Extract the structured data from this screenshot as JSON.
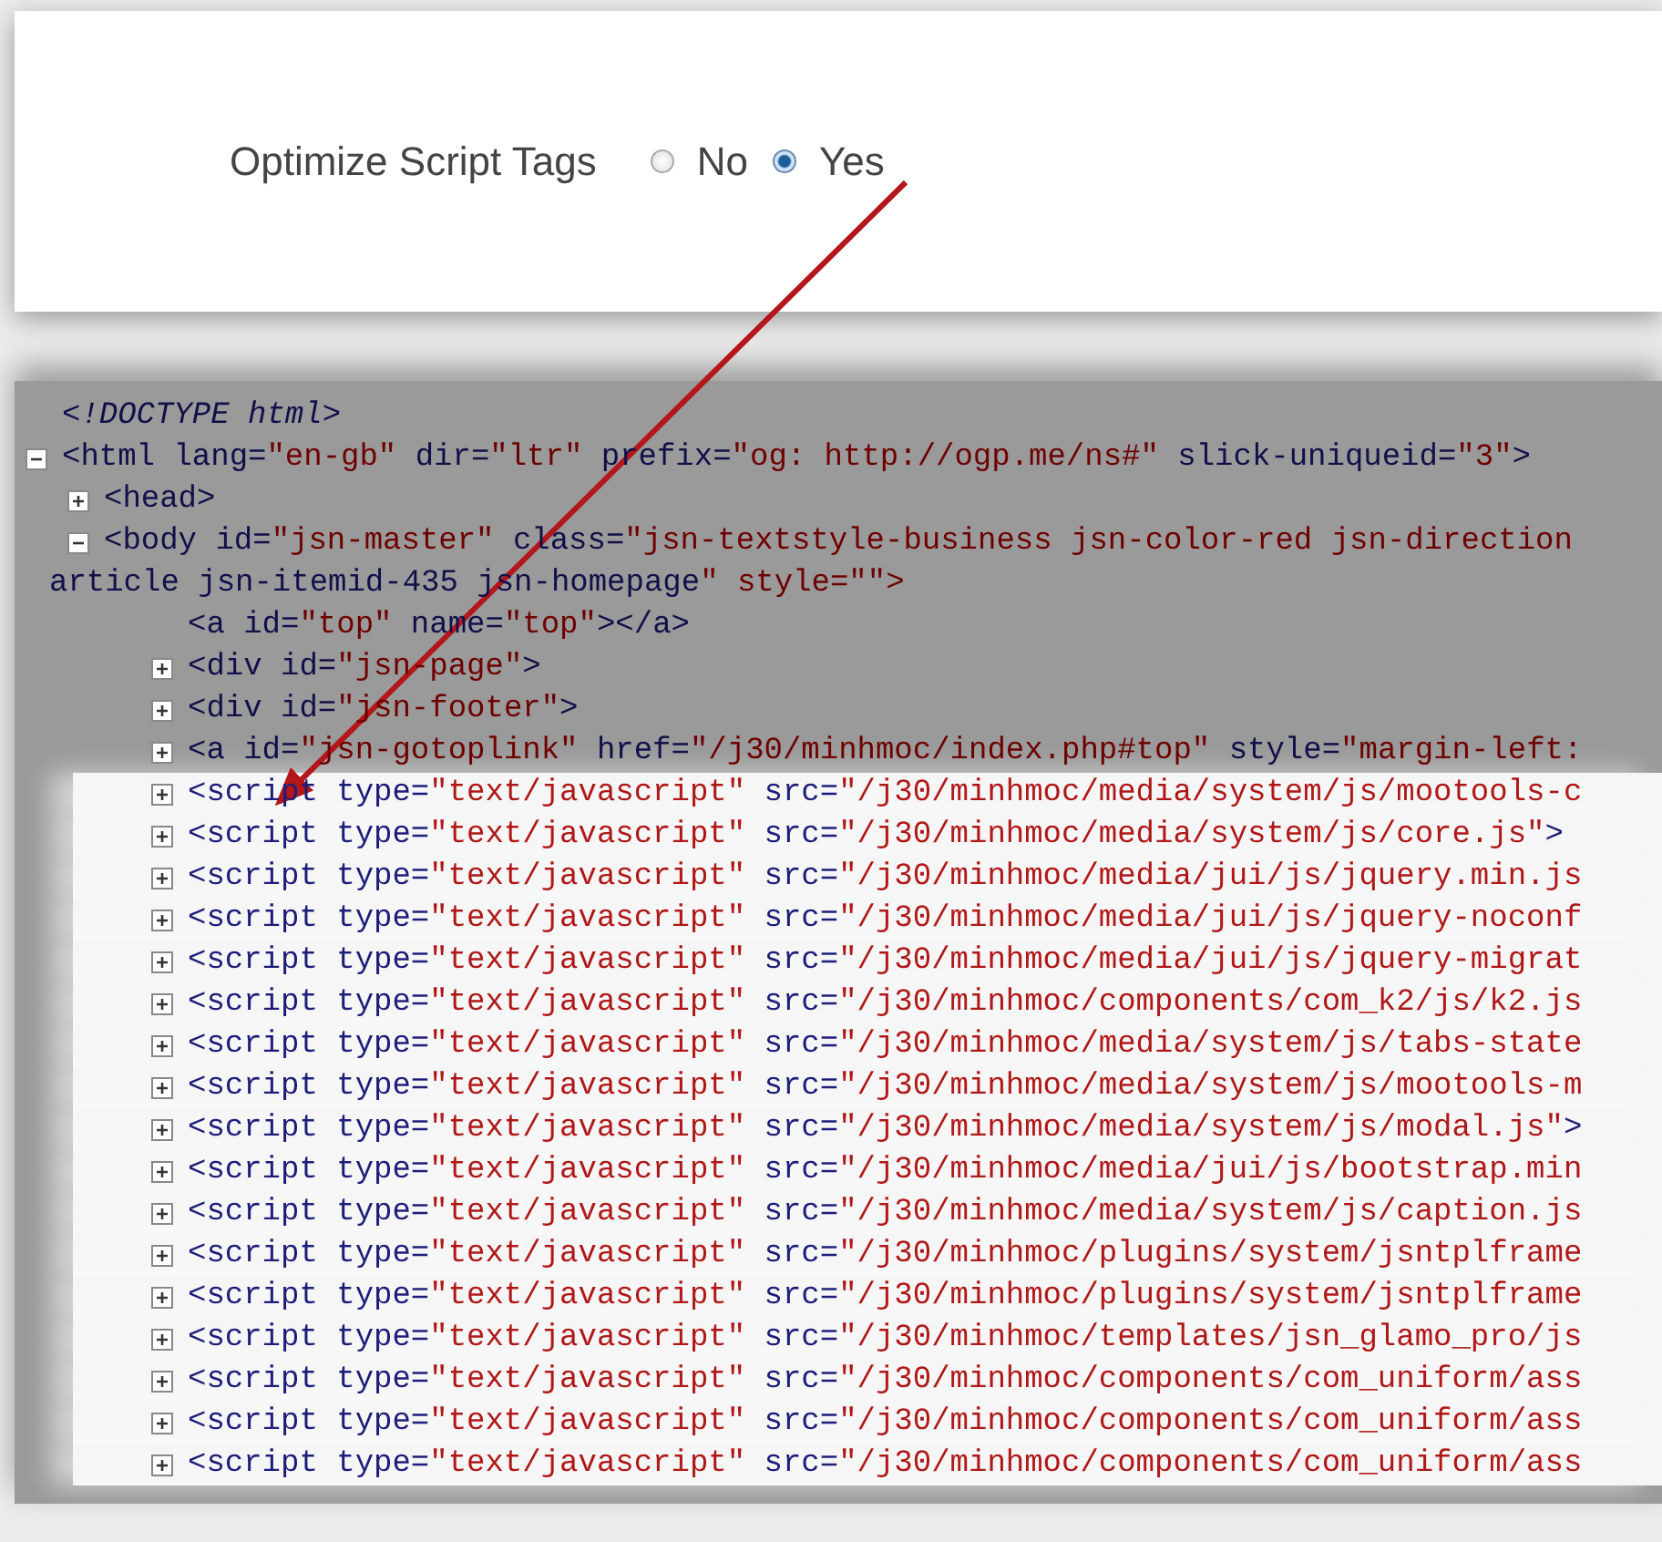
{
  "setting": {
    "label": "Optimize Script Tags",
    "options": [
      {
        "label": "No",
        "selected": false
      },
      {
        "label": "Yes",
        "selected": true
      }
    ]
  },
  "source_tree": [
    {
      "kind": "doctype",
      "lines": [
        "<!DOCTYPE html>"
      ]
    },
    {
      "kind": "element",
      "expanded": true,
      "lines": [
        "<html lang=\"en-gb\" dir=\"ltr\" prefix=\"og: http://ogp.me/ns#\" slick-uniqueid=\"3\">"
      ],
      "children": [
        {
          "expanded": false,
          "lines": [
            "<head>"
          ]
        },
        {
          "expanded": true,
          "lines": [
            "<body id=\"jsn-master\" class=\"jsn-textstyle-business jsn-color-red jsn-direction",
            "article jsn-itemid-435 jsn-homepage\" style=\"\">"
          ],
          "children": [
            {
              "lines": [
                "<a id=\"top\" name=\"top\"></a>"
              ]
            },
            {
              "expanded": false,
              "lines": [
                "<div id=\"jsn-page\">"
              ]
            },
            {
              "expanded": false,
              "lines": [
                "<div id=\"jsn-footer\">"
              ]
            },
            {
              "expanded": false,
              "lines": [
                "<a id=\"jsn-gotoplink\" href=\"/j30/minhmoc/index.php#top\" style=\"margin-left:"
              ]
            },
            {
              "expanded": false,
              "highlighted": true,
              "lines": [
                "<script type=\"text/javascript\" src=\"/j30/minhmoc/media/system/js/mootools-c"
              ]
            },
            {
              "expanded": false,
              "highlighted": true,
              "lines": [
                "<script type=\"text/javascript\" src=\"/j30/minhmoc/media/system/js/core.js\">"
              ]
            },
            {
              "expanded": false,
              "highlighted": true,
              "lines": [
                "<script type=\"text/javascript\" src=\"/j30/minhmoc/media/jui/js/jquery.min.js"
              ]
            },
            {
              "expanded": false,
              "highlighted": true,
              "lines": [
                "<script type=\"text/javascript\" src=\"/j30/minhmoc/media/jui/js/jquery-noconf"
              ]
            },
            {
              "expanded": false,
              "highlighted": true,
              "lines": [
                "<script type=\"text/javascript\" src=\"/j30/minhmoc/media/jui/js/jquery-migrat"
              ]
            },
            {
              "expanded": false,
              "highlighted": true,
              "lines": [
                "<script type=\"text/javascript\" src=\"/j30/minhmoc/components/com_k2/js/k2.js"
              ]
            },
            {
              "expanded": false,
              "highlighted": true,
              "lines": [
                "<script type=\"text/javascript\" src=\"/j30/minhmoc/media/system/js/tabs-state"
              ]
            },
            {
              "expanded": false,
              "highlighted": true,
              "lines": [
                "<script type=\"text/javascript\" src=\"/j30/minhmoc/media/system/js/mootools-m"
              ]
            },
            {
              "expanded": false,
              "highlighted": true,
              "lines": [
                "<script type=\"text/javascript\" src=\"/j30/minhmoc/media/system/js/modal.js\">"
              ]
            },
            {
              "expanded": false,
              "highlighted": true,
              "lines": [
                "<script type=\"text/javascript\" src=\"/j30/minhmoc/media/jui/js/bootstrap.min"
              ]
            },
            {
              "expanded": false,
              "highlighted": true,
              "lines": [
                "<script type=\"text/javascript\" src=\"/j30/minhmoc/media/system/js/caption.js"
              ]
            },
            {
              "expanded": false,
              "highlighted": true,
              "lines": [
                "<script type=\"text/javascript\" src=\"/j30/minhmoc/plugins/system/jsntplframe"
              ]
            },
            {
              "expanded": false,
              "highlighted": true,
              "lines": [
                "<script type=\"text/javascript\" src=\"/j30/minhmoc/plugins/system/jsntplframe"
              ]
            },
            {
              "expanded": false,
              "highlighted": true,
              "lines": [
                "<script type=\"text/javascript\" src=\"/j30/minhmoc/templates/jsn_glamo_pro/js"
              ]
            },
            {
              "expanded": false,
              "highlighted": true,
              "lines": [
                "<script type=\"text/javascript\" src=\"/j30/minhmoc/components/com_uniform/ass"
              ]
            },
            {
              "expanded": false,
              "highlighted": true,
              "lines": [
                "<script type=\"text/javascript\" src=\"/j30/minhmoc/components/com_uniform/ass"
              ]
            },
            {
              "expanded": false,
              "highlighted": true,
              "lines": [
                "<script type=\"text/javascript\" src=\"/j30/minhmoc/components/com_uniform/ass"
              ]
            }
          ]
        }
      ]
    }
  ]
}
